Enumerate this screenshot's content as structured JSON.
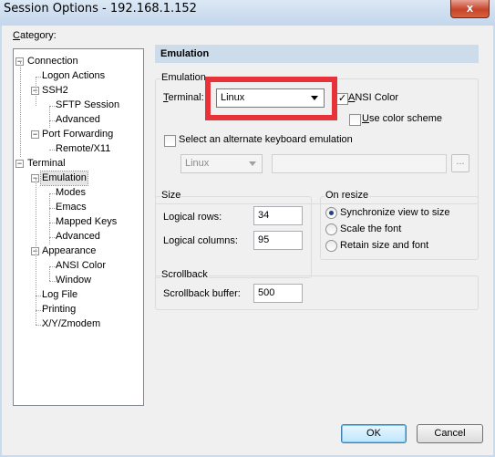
{
  "window": {
    "title": "Session Options - 192.168.1.152",
    "close_label": "x"
  },
  "category": {
    "label": "Category:",
    "tree": [
      {
        "id": "connection",
        "label": "Connection",
        "level": 0,
        "expanded": true
      },
      {
        "id": "logon-actions",
        "label": "Logon Actions",
        "level": 1
      },
      {
        "id": "ssh2",
        "label": "SSH2",
        "level": 1,
        "expanded": true
      },
      {
        "id": "sftp-session",
        "label": "SFTP Session",
        "level": 2
      },
      {
        "id": "advanced-ssh2",
        "label": "Advanced",
        "level": 2
      },
      {
        "id": "port-forwarding",
        "label": "Port Forwarding",
        "level": 1,
        "expanded": true
      },
      {
        "id": "remote-x11",
        "label": "Remote/X11",
        "level": 2
      },
      {
        "id": "terminal",
        "label": "Terminal",
        "level": 0,
        "expanded": true
      },
      {
        "id": "emulation",
        "label": "Emulation",
        "level": 1,
        "expanded": true,
        "selected": true
      },
      {
        "id": "modes",
        "label": "Modes",
        "level": 2
      },
      {
        "id": "emacs",
        "label": "Emacs",
        "level": 2
      },
      {
        "id": "mapped-keys",
        "label": "Mapped Keys",
        "level": 2
      },
      {
        "id": "advanced-emulation",
        "label": "Advanced",
        "level": 2
      },
      {
        "id": "appearance",
        "label": "Appearance",
        "level": 1,
        "expanded": true
      },
      {
        "id": "ansi-color",
        "label": "ANSI Color",
        "level": 2
      },
      {
        "id": "window",
        "label": "Window",
        "level": 2
      },
      {
        "id": "log-file",
        "label": "Log File",
        "level": 1
      },
      {
        "id": "printing",
        "label": "Printing",
        "level": 1
      },
      {
        "id": "xyzmodem",
        "label": "X/Y/Zmodem",
        "level": 1
      }
    ]
  },
  "panel": {
    "header": "Emulation",
    "emulation_group": {
      "title": "Emulation",
      "terminal_label": "Terminal:",
      "terminal_value": "Linux",
      "ansi_color_label": "ANSI Color",
      "ansi_color_checked": true,
      "use_color_scheme_label": "Use color scheme",
      "use_color_scheme_checked": false,
      "alternate_keyboard_label": "Select an alternate keyboard emulation",
      "alternate_keyboard_checked": false,
      "alternate_keyboard_value": "Linux",
      "alternate_keyboard_path": "",
      "browse_label": "..."
    },
    "size_group": {
      "title": "Size",
      "logical_rows_label": "Logical rows:",
      "logical_rows_value": "34",
      "logical_columns_label": "Logical columns:",
      "logical_columns_value": "95"
    },
    "resize_group": {
      "title": "On resize",
      "options": [
        {
          "label": "Synchronize view to size",
          "selected": true
        },
        {
          "label": "Scale the font",
          "selected": false
        },
        {
          "label": "Retain size and font",
          "selected": false
        }
      ]
    },
    "scrollback_group": {
      "title": "Scrollback",
      "buffer_label": "Scrollback buffer:",
      "buffer_value": "500"
    }
  },
  "buttons": {
    "ok": "OK",
    "cancel": "Cancel"
  },
  "colors": {
    "highlight_box": "#e8323a",
    "header_bg": "#cddcea",
    "title_bg": "#c9dced"
  }
}
